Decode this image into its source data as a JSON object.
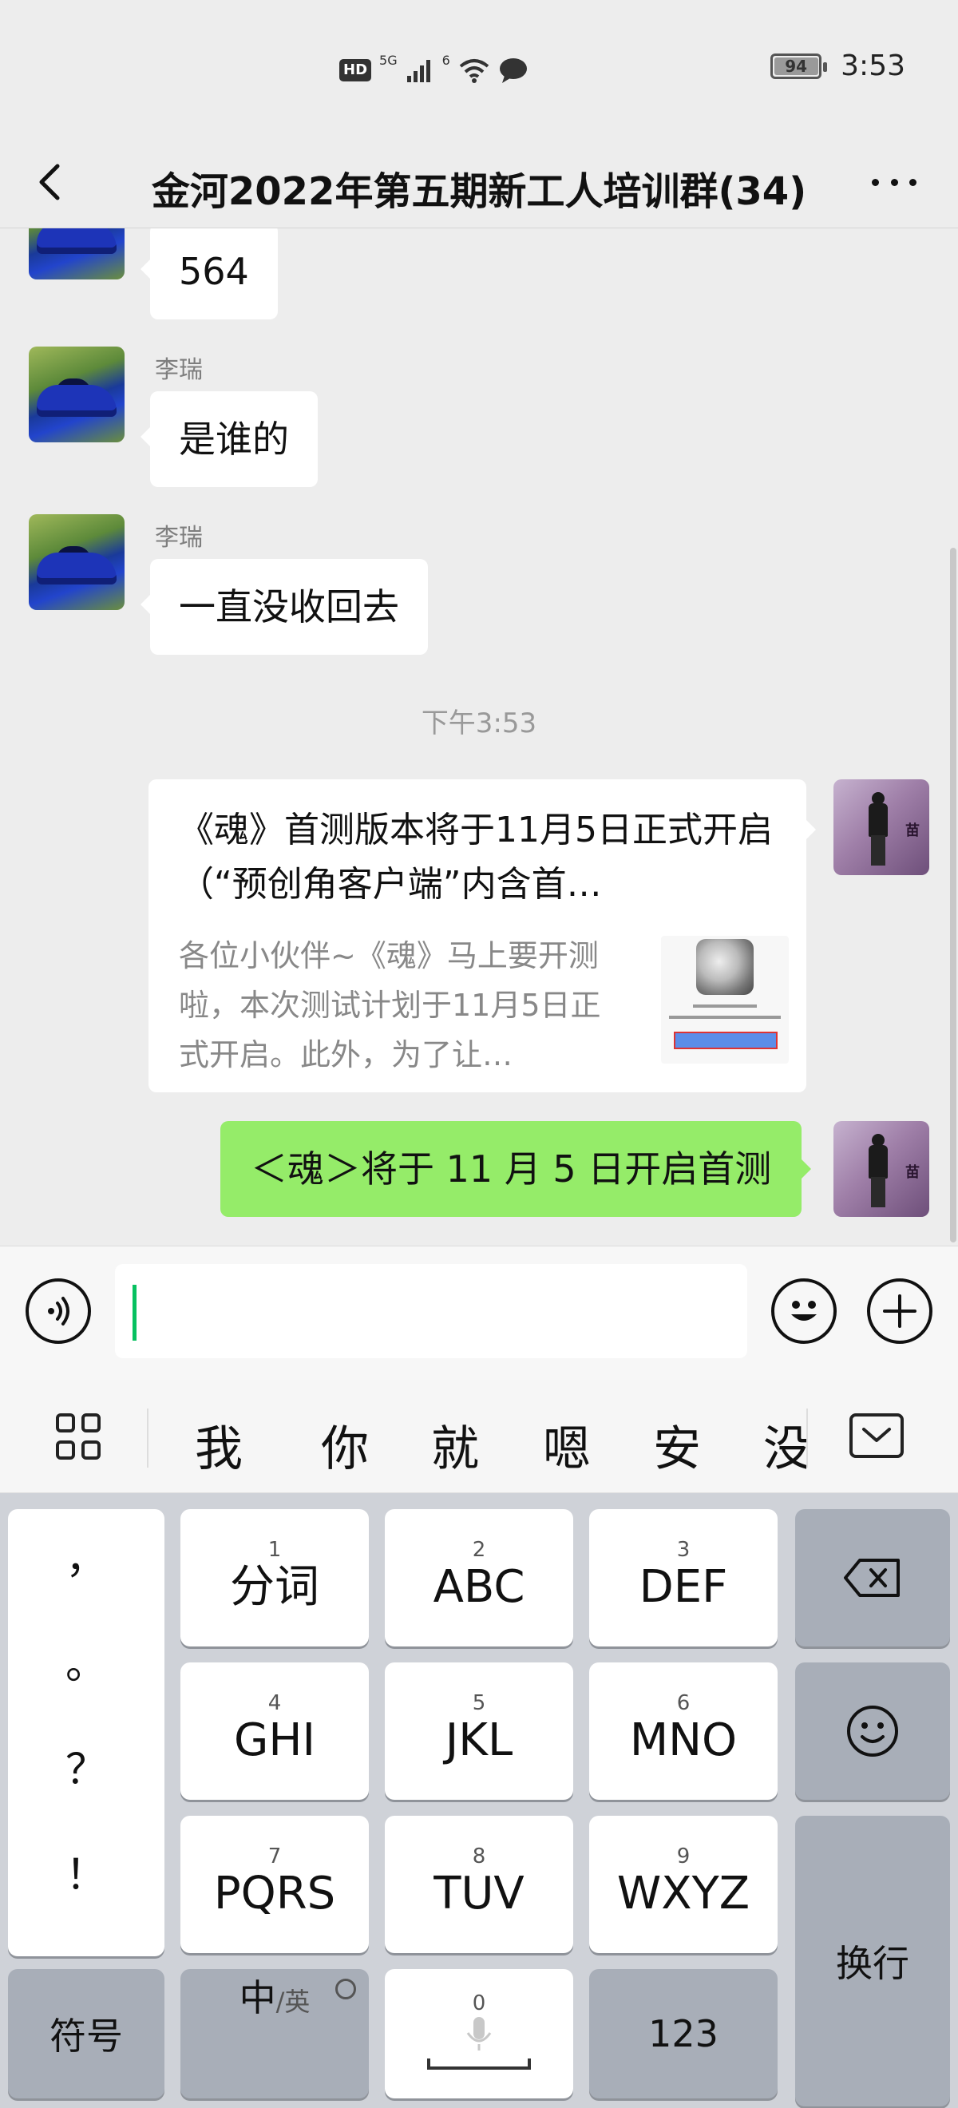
{
  "status_bar": {
    "hd": "HD",
    "network": "5G",
    "sim_index": "6",
    "battery": "94",
    "battery_level": 0.94,
    "time": "3:53"
  },
  "nav": {
    "title": "金河2022年第五期新工人培训群(34)"
  },
  "messages": [
    {
      "text": "564"
    },
    {
      "sender": "李瑞",
      "text": "是谁的"
    },
    {
      "sender": "李瑞",
      "text": "一直没收回去"
    }
  ],
  "timestamp": "下午3:53",
  "link_card": {
    "title": "《魂》首测版本将于11月5日正式开启（“预创角客户端”内含首…",
    "description": "各位小伙伴~《魂》马上要开测啦，本次测试计划于11月5日正式开启。此外，为了让…"
  },
  "my_message": "＜魂＞将于 11 月 5 日开启首测",
  "avatar_text": "苗",
  "candidates": [
    "我",
    "你",
    "就",
    "嗯",
    "安",
    "没"
  ],
  "keyboard": {
    "punct": [
      "，",
      "。",
      "？",
      "！"
    ],
    "keys": [
      {
        "num": "1",
        "label": "分词"
      },
      {
        "num": "2",
        "label": "ABC"
      },
      {
        "num": "3",
        "label": "DEF"
      },
      {
        "num": "4",
        "label": "GHI"
      },
      {
        "num": "5",
        "label": "JKL"
      },
      {
        "num": "6",
        "label": "MNO"
      },
      {
        "num": "7",
        "label": "PQRS"
      },
      {
        "num": "8",
        "label": "TUV"
      },
      {
        "num": "9",
        "label": "WXYZ"
      }
    ],
    "symbols": "符号",
    "lang_main": "中",
    "lang_sub": "/英",
    "space_num": "0",
    "digits": "123",
    "enter": "换行"
  }
}
